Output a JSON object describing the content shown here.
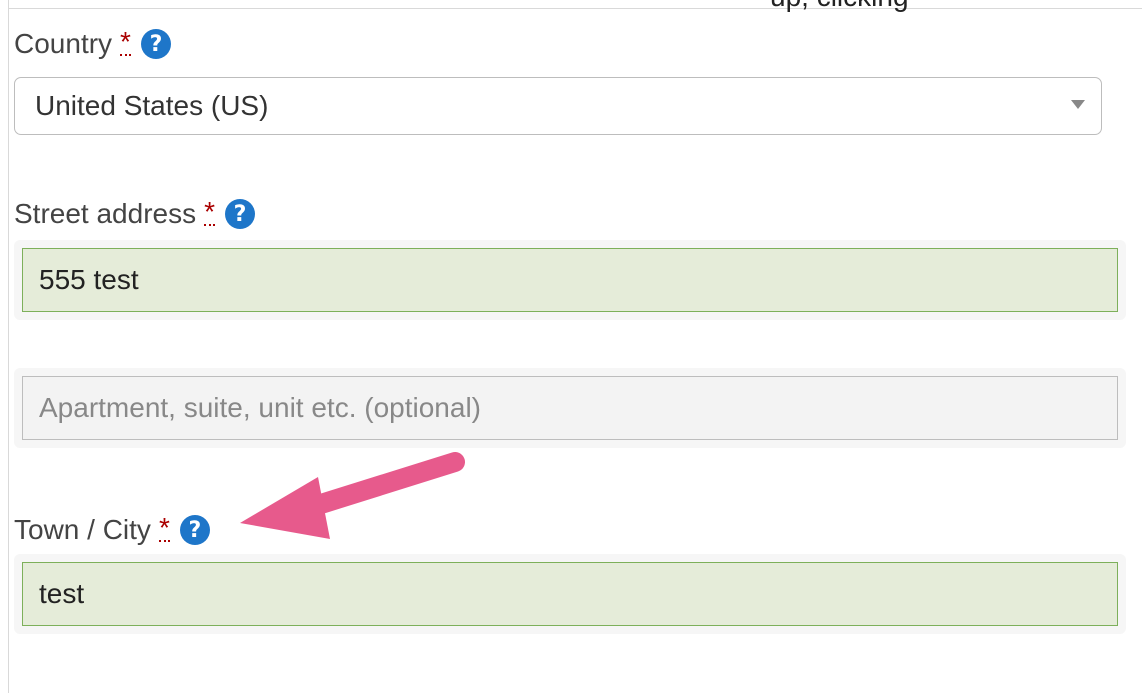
{
  "top_cut_text": "up, clicking",
  "fields": {
    "country": {
      "label": "Country",
      "required": "*",
      "value": "United States (US)"
    },
    "street": {
      "label": "Street address",
      "required": "*",
      "value": "555 test"
    },
    "apartment": {
      "placeholder": "Apartment, suite, unit etc. (optional)"
    },
    "city": {
      "label": "Town / City",
      "required": "*",
      "value": "test"
    }
  },
  "icons": {
    "help": "?",
    "arrow_color": "#e75a8c",
    "help_color": "#1e76c9"
  }
}
